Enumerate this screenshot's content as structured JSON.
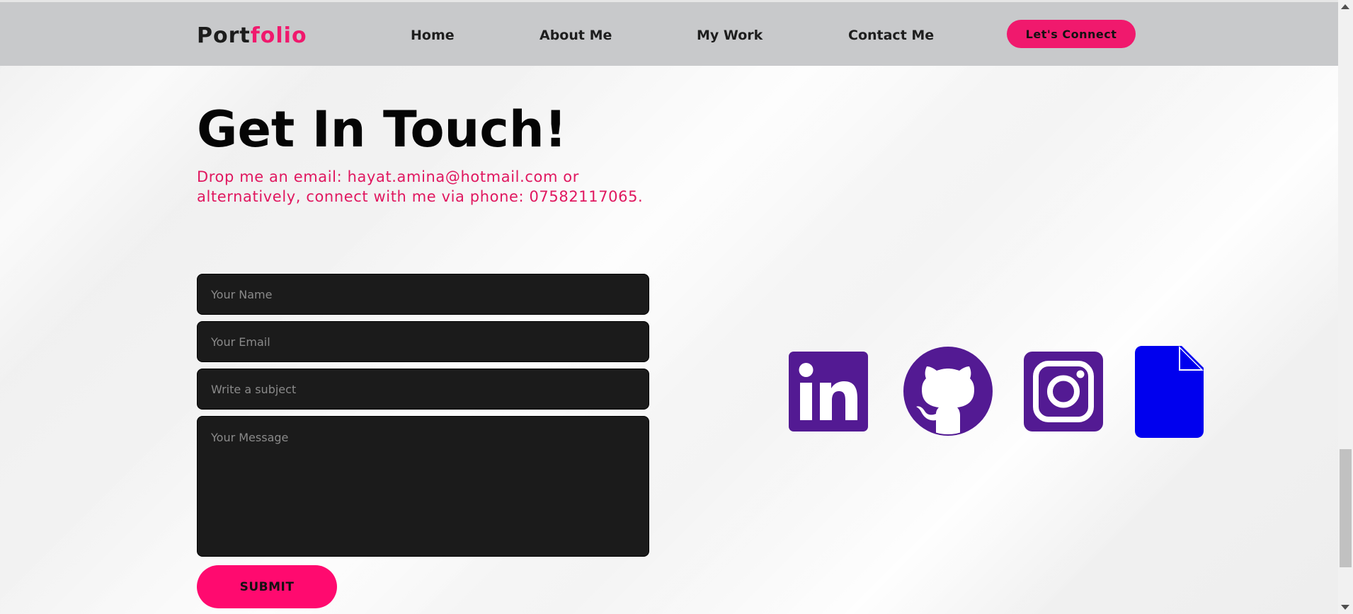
{
  "nav": {
    "logo_main": "Port",
    "logo_accent": "folio",
    "links": [
      "Home",
      "About Me",
      "My Work",
      "Contact Me"
    ],
    "cta_label": "Let's Connect"
  },
  "contact": {
    "title": "Get In Touch!",
    "intro": "Drop me an email: hayat.amina@hotmail.com or alternatively, connect with me via phone: 07582117065.",
    "form": {
      "name_placeholder": "Your Name",
      "email_placeholder": "Your Email",
      "subject_placeholder": "Write a subject",
      "message_placeholder": "Your Message",
      "submit_label": "SUBMIT"
    }
  },
  "social": {
    "icons": [
      "linkedin-icon",
      "github-icon",
      "instagram-icon",
      "document-icon"
    ]
  },
  "colors": {
    "accent": "#f0196d",
    "navbar": "#c8c9cb",
    "social_purple": "#531a93",
    "document_blue": "#0000ee",
    "field_bg": "#1b1b1b"
  }
}
